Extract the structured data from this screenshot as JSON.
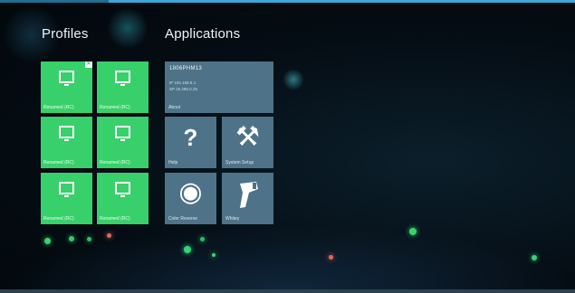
{
  "colors": {
    "accent": "#3aa9d8",
    "profile_tile": "#38d06a",
    "app_tile": "#4e7388"
  },
  "profiles": {
    "title": "Profiles",
    "items": [
      {
        "label": "Renamed (RC)",
        "icon": "monitor-icon",
        "active": true
      },
      {
        "label": "Renamed (RC)",
        "icon": "monitor-icon",
        "active": false
      },
      {
        "label": "Renamed (RC)",
        "icon": "monitor-icon",
        "active": false
      },
      {
        "label": "Renamed (RC)",
        "icon": "monitor-icon",
        "active": false
      },
      {
        "label": "Renamed (RC)",
        "icon": "monitor-icon",
        "active": false
      },
      {
        "label": "Renamed (RC)",
        "icon": "monitor-icon",
        "active": false
      }
    ],
    "active_badge": "✕"
  },
  "applications": {
    "title": "Applications",
    "about": {
      "title": "1806PHM13",
      "line1": "IP 192.168.8.1",
      "line2": "SP 25.285.0.25",
      "label": "About"
    },
    "help": {
      "label": "Help",
      "icon": "question-mark-icon",
      "glyph": "?"
    },
    "settings": {
      "label": "System Setup",
      "icon": "tools-icon",
      "glyph": "⚒"
    },
    "radar": {
      "label": "Color Reverse",
      "icon": "radar-icon",
      "glyph": "◉"
    },
    "scanner": {
      "label": "Whitey",
      "icon": "barcode-scanner-icon",
      "glyph": "⌐"
    }
  }
}
